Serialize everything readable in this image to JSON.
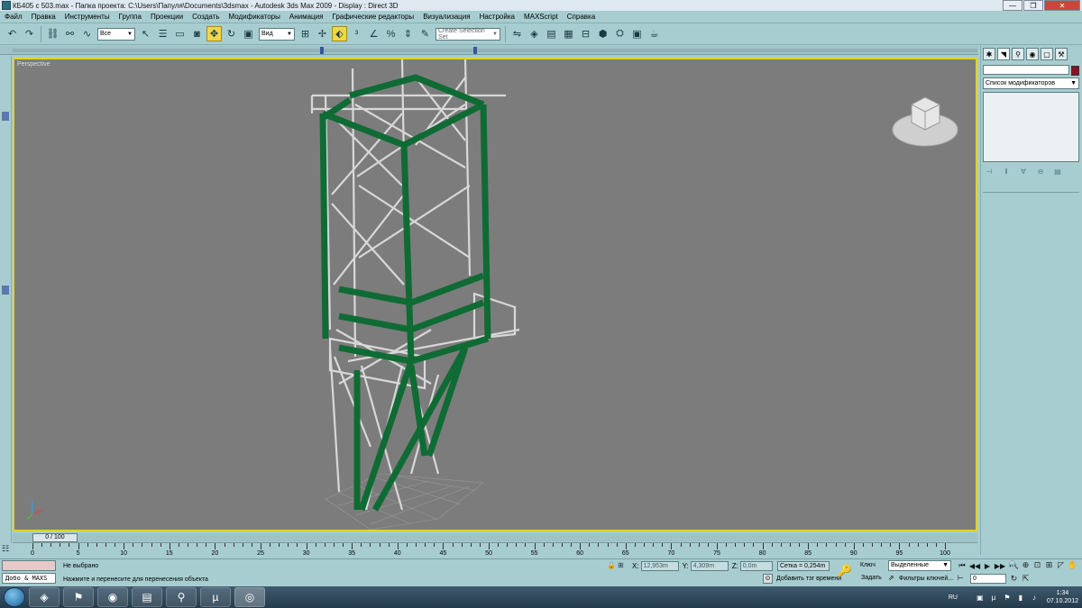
{
  "window": {
    "title": "КБ405 с 503.max    -  Папка проекта: C:\\Users\\Папуля\\Documents\\3dsmax    -  Autodesk 3ds Max  2009      -  Display : Direct 3D",
    "min_glyph": "—",
    "max_glyph": "❐",
    "close_glyph": "✕"
  },
  "menu": [
    "Файл",
    "Правка",
    "Инструменты",
    "Группа",
    "Проекции",
    "Создать",
    "Модификаторы",
    "Анимация",
    "Графические редакторы",
    "Визуализация",
    "Настройка",
    "MAXScript",
    "Справка"
  ],
  "toolbar": {
    "selection_filter": "Все",
    "ref_coord": "Вид",
    "named_selection_placeholder": "Create Selection Set"
  },
  "viewport": {
    "label": "Perspective"
  },
  "command_panel": {
    "modifier_list": "Список модификаторов"
  },
  "time_slider": {
    "value": "0 / 100"
  },
  "ruler": {
    "ticks": [
      "0",
      "5",
      "10",
      "15",
      "20",
      "25",
      "30",
      "35",
      "40",
      "45",
      "50",
      "55",
      "60",
      "65",
      "70",
      "75",
      "80",
      "85",
      "90",
      "95",
      "100"
    ]
  },
  "status": {
    "maxscript_label": "Добо & MAXS",
    "selection": "Не выбрано",
    "prompt": "Нажмите и перенесите для перенесения объекта",
    "x_label": "X:",
    "x_value": "12,953m",
    "y_label": "Y:",
    "y_value": "4,309m",
    "z_label": "Z:",
    "z_value": "0,0m",
    "grid": "Сетка = 0,254m",
    "add_time_tag": "Добавить тэг времени",
    "key_label": "Ключ",
    "set_key_label": "Задать",
    "key_mode": "Выделенные",
    "key_filters": "Фильтры ключей...",
    "current_frame": "0"
  },
  "taskbar": {
    "lang": "RU",
    "time": "1:34",
    "date": "07.10.2012"
  },
  "colors": {
    "ui_bg": "#a7cdd0",
    "viewport_bg": "#7c7c7c",
    "viewport_border_active": "#e0d230",
    "model_green": "#0f6b34",
    "model_gray": "#d6d6d6",
    "object_color_swatch": "#8a1024"
  }
}
